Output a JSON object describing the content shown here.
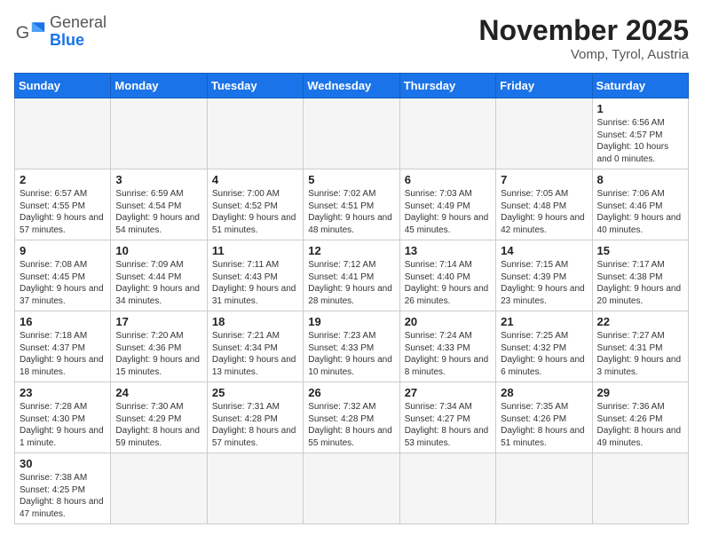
{
  "header": {
    "logo_general": "General",
    "logo_blue": "Blue",
    "title": "November 2025",
    "location": "Vomp, Tyrol, Austria"
  },
  "weekdays": [
    "Sunday",
    "Monday",
    "Tuesday",
    "Wednesday",
    "Thursday",
    "Friday",
    "Saturday"
  ],
  "weeks": [
    [
      {
        "day": "",
        "info": ""
      },
      {
        "day": "",
        "info": ""
      },
      {
        "day": "",
        "info": ""
      },
      {
        "day": "",
        "info": ""
      },
      {
        "day": "",
        "info": ""
      },
      {
        "day": "",
        "info": ""
      },
      {
        "day": "1",
        "info": "Sunrise: 6:56 AM\nSunset: 4:57 PM\nDaylight: 10 hours and 0 minutes."
      }
    ],
    [
      {
        "day": "2",
        "info": "Sunrise: 6:57 AM\nSunset: 4:55 PM\nDaylight: 9 hours and 57 minutes."
      },
      {
        "day": "3",
        "info": "Sunrise: 6:59 AM\nSunset: 4:54 PM\nDaylight: 9 hours and 54 minutes."
      },
      {
        "day": "4",
        "info": "Sunrise: 7:00 AM\nSunset: 4:52 PM\nDaylight: 9 hours and 51 minutes."
      },
      {
        "day": "5",
        "info": "Sunrise: 7:02 AM\nSunset: 4:51 PM\nDaylight: 9 hours and 48 minutes."
      },
      {
        "day": "6",
        "info": "Sunrise: 7:03 AM\nSunset: 4:49 PM\nDaylight: 9 hours and 45 minutes."
      },
      {
        "day": "7",
        "info": "Sunrise: 7:05 AM\nSunset: 4:48 PM\nDaylight: 9 hours and 42 minutes."
      },
      {
        "day": "8",
        "info": "Sunrise: 7:06 AM\nSunset: 4:46 PM\nDaylight: 9 hours and 40 minutes."
      }
    ],
    [
      {
        "day": "9",
        "info": "Sunrise: 7:08 AM\nSunset: 4:45 PM\nDaylight: 9 hours and 37 minutes."
      },
      {
        "day": "10",
        "info": "Sunrise: 7:09 AM\nSunset: 4:44 PM\nDaylight: 9 hours and 34 minutes."
      },
      {
        "day": "11",
        "info": "Sunrise: 7:11 AM\nSunset: 4:43 PM\nDaylight: 9 hours and 31 minutes."
      },
      {
        "day": "12",
        "info": "Sunrise: 7:12 AM\nSunset: 4:41 PM\nDaylight: 9 hours and 28 minutes."
      },
      {
        "day": "13",
        "info": "Sunrise: 7:14 AM\nSunset: 4:40 PM\nDaylight: 9 hours and 26 minutes."
      },
      {
        "day": "14",
        "info": "Sunrise: 7:15 AM\nSunset: 4:39 PM\nDaylight: 9 hours and 23 minutes."
      },
      {
        "day": "15",
        "info": "Sunrise: 7:17 AM\nSunset: 4:38 PM\nDaylight: 9 hours and 20 minutes."
      }
    ],
    [
      {
        "day": "16",
        "info": "Sunrise: 7:18 AM\nSunset: 4:37 PM\nDaylight: 9 hours and 18 minutes."
      },
      {
        "day": "17",
        "info": "Sunrise: 7:20 AM\nSunset: 4:36 PM\nDaylight: 9 hours and 15 minutes."
      },
      {
        "day": "18",
        "info": "Sunrise: 7:21 AM\nSunset: 4:34 PM\nDaylight: 9 hours and 13 minutes."
      },
      {
        "day": "19",
        "info": "Sunrise: 7:23 AM\nSunset: 4:33 PM\nDaylight: 9 hours and 10 minutes."
      },
      {
        "day": "20",
        "info": "Sunrise: 7:24 AM\nSunset: 4:33 PM\nDaylight: 9 hours and 8 minutes."
      },
      {
        "day": "21",
        "info": "Sunrise: 7:25 AM\nSunset: 4:32 PM\nDaylight: 9 hours and 6 minutes."
      },
      {
        "day": "22",
        "info": "Sunrise: 7:27 AM\nSunset: 4:31 PM\nDaylight: 9 hours and 3 minutes."
      }
    ],
    [
      {
        "day": "23",
        "info": "Sunrise: 7:28 AM\nSunset: 4:30 PM\nDaylight: 9 hours and 1 minute."
      },
      {
        "day": "24",
        "info": "Sunrise: 7:30 AM\nSunset: 4:29 PM\nDaylight: 8 hours and 59 minutes."
      },
      {
        "day": "25",
        "info": "Sunrise: 7:31 AM\nSunset: 4:28 PM\nDaylight: 8 hours and 57 minutes."
      },
      {
        "day": "26",
        "info": "Sunrise: 7:32 AM\nSunset: 4:28 PM\nDaylight: 8 hours and 55 minutes."
      },
      {
        "day": "27",
        "info": "Sunrise: 7:34 AM\nSunset: 4:27 PM\nDaylight: 8 hours and 53 minutes."
      },
      {
        "day": "28",
        "info": "Sunrise: 7:35 AM\nSunset: 4:26 PM\nDaylight: 8 hours and 51 minutes."
      },
      {
        "day": "29",
        "info": "Sunrise: 7:36 AM\nSunset: 4:26 PM\nDaylight: 8 hours and 49 minutes."
      }
    ],
    [
      {
        "day": "30",
        "info": "Sunrise: 7:38 AM\nSunset: 4:25 PM\nDaylight: 8 hours and 47 minutes."
      },
      {
        "day": "",
        "info": ""
      },
      {
        "day": "",
        "info": ""
      },
      {
        "day": "",
        "info": ""
      },
      {
        "day": "",
        "info": ""
      },
      {
        "day": "",
        "info": ""
      },
      {
        "day": "",
        "info": ""
      }
    ]
  ]
}
